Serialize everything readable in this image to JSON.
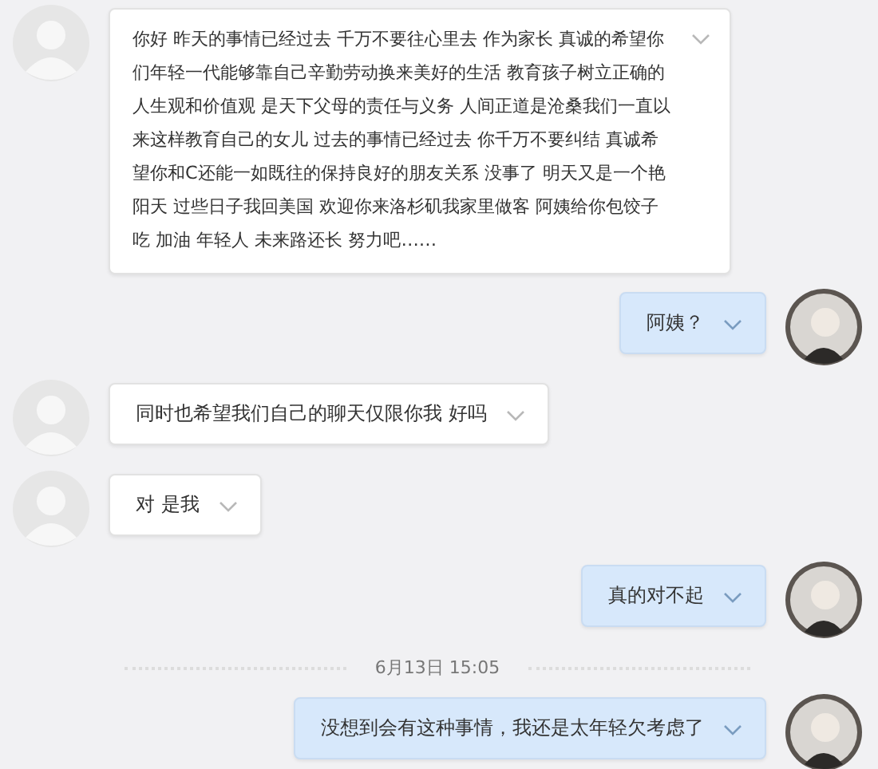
{
  "messages": [
    {
      "kind": "message",
      "from_me": false,
      "text": "你好 昨天的事情已经过去 千万不要往心里去 作为家长 真诚的希望你们年轻一代能够靠自己辛勤劳动换来美好的生活 教育孩子树立正确的人生观和价值观 是天下父母的责任与义务 人间正道是沧桑我们一直以来这样教育自己的女儿 过去的事情已经过去 你千万不要纠结 真诚希望你和C还能一如既往的保持良好的朋友关系 没事了 明天又是一个艳阳天 过些日子我回美国 欢迎你来洛杉矶我家里做客 阿姨给你包饺子吃 加油 年轻人 未来路还长 努力吧……"
    },
    {
      "kind": "message",
      "from_me": true,
      "text": "阿姨？"
    },
    {
      "kind": "message",
      "from_me": false,
      "text": "同时也希望我们自己的聊天仅限你我 好吗"
    },
    {
      "kind": "message",
      "from_me": false,
      "text": "对 是我"
    },
    {
      "kind": "message",
      "from_me": true,
      "text": "真的对不起"
    },
    {
      "kind": "time",
      "text": "6月13日 15:05"
    },
    {
      "kind": "message",
      "from_me": true,
      "text": "没想到会有这种事情，我还是太年轻欠考虑了"
    }
  ]
}
